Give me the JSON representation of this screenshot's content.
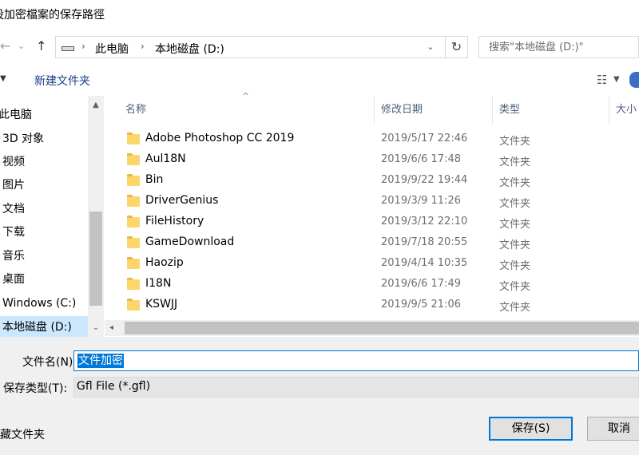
{
  "window": {
    "title": "设加密檔案的保存路徑"
  },
  "address": {
    "crumbs": [
      "此电脑",
      "本地磁盘 (D:)"
    ],
    "search_placeholder": "搜索\"本地磁盘 (D:)\""
  },
  "toolbar": {
    "new_folder": "新建文件夹"
  },
  "nav": {
    "items": [
      {
        "label": "此电脑",
        "selected": false
      },
      {
        "label": "3D 对象",
        "selected": false
      },
      {
        "label": "视频",
        "selected": false
      },
      {
        "label": "图片",
        "selected": false
      },
      {
        "label": "文档",
        "selected": false
      },
      {
        "label": "下载",
        "selected": false
      },
      {
        "label": "音乐",
        "selected": false
      },
      {
        "label": "桌面",
        "selected": false
      },
      {
        "label": "Windows (C:)",
        "selected": false
      },
      {
        "label": "本地磁盘 (D:)",
        "selected": true
      }
    ]
  },
  "columns": {
    "name": "名称",
    "date": "修改日期",
    "type": "类型",
    "size": "大小"
  },
  "files": [
    {
      "name": "Adobe Photoshop CC 2019",
      "date": "2019/5/17 22:46",
      "type": "文件夹"
    },
    {
      "name": "Aul18N",
      "date": "2019/6/6 17:48",
      "type": "文件夹"
    },
    {
      "name": "Bin",
      "date": "2019/9/22 19:44",
      "type": "文件夹"
    },
    {
      "name": "DriverGenius",
      "date": "2019/3/9 11:26",
      "type": "文件夹"
    },
    {
      "name": "FileHistory",
      "date": "2019/3/12 22:10",
      "type": "文件夹"
    },
    {
      "name": "GameDownload",
      "date": "2019/7/18 20:55",
      "type": "文件夹"
    },
    {
      "name": "Haozip",
      "date": "2019/4/14 10:35",
      "type": "文件夹"
    },
    {
      "name": "I18N",
      "date": "2019/6/6 17:49",
      "type": "文件夹"
    },
    {
      "name": "KSWJJ",
      "date": "2019/9/5 21:06",
      "type": "文件夹"
    }
  ],
  "form": {
    "filename_label": "文件名(N):",
    "filename_value": "文件加密",
    "filetype_label": "保存类型(T):",
    "filetype_value": "Gfl File (*.gfl)"
  },
  "footer": {
    "hide_folders": "隐藏文件夹",
    "save": "保存(S)",
    "cancel": "取消"
  },
  "colors": {
    "accent": "#0078d7",
    "selection": "#cce8ff",
    "folder": "#fcd56b"
  }
}
